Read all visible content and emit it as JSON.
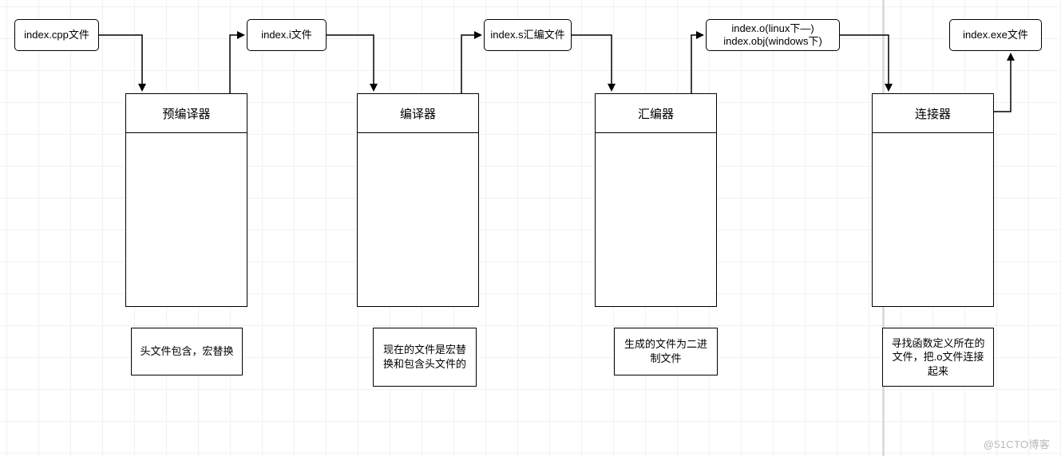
{
  "chart_data": {
    "type": "flowchart",
    "direction": "left-to-right",
    "nodes": [
      {
        "id": "n_src",
        "kind": "file",
        "label": "index.cpp文件"
      },
      {
        "id": "n_i",
        "kind": "file",
        "label": "index.i文件"
      },
      {
        "id": "n_s",
        "kind": "file",
        "label": "index.s汇编文件"
      },
      {
        "id": "n_o",
        "kind": "file",
        "label": "index.o(linux下—)\nindex.obj(windows下)"
      },
      {
        "id": "n_exe",
        "kind": "file",
        "label": "index.exe文件"
      },
      {
        "id": "s_pre",
        "kind": "stage",
        "label": "预编译器"
      },
      {
        "id": "s_comp",
        "kind": "stage",
        "label": "编译器"
      },
      {
        "id": "s_asm",
        "kind": "stage",
        "label": "汇编器"
      },
      {
        "id": "s_link",
        "kind": "stage",
        "label": "连接器"
      },
      {
        "id": "d_pre",
        "kind": "desc",
        "label": "头文件包含，宏替换"
      },
      {
        "id": "d_comp",
        "kind": "desc",
        "label": "现在的文件是宏替换和包含头文件的"
      },
      {
        "id": "d_asm",
        "kind": "desc",
        "label": "生成的文件为二进制文件"
      },
      {
        "id": "d_link",
        "kind": "desc",
        "label": "寻找函数定义所在的文件，把.o文件连接起来"
      }
    ],
    "edges": [
      {
        "from": "n_src",
        "to": "s_pre"
      },
      {
        "from": "s_pre",
        "to": "n_i"
      },
      {
        "from": "n_i",
        "to": "s_comp"
      },
      {
        "from": "s_comp",
        "to": "n_s"
      },
      {
        "from": "n_s",
        "to": "s_asm"
      },
      {
        "from": "s_asm",
        "to": "n_o"
      },
      {
        "from": "n_o",
        "to": "s_link"
      },
      {
        "from": "s_link",
        "to": "n_exe"
      }
    ]
  },
  "files": {
    "src": "index.cpp文件",
    "i": "index.i文件",
    "s": "index.s汇编文件",
    "o": "index.o(linux下—)\nindex.obj(windows下)",
    "exe": "index.exe文件"
  },
  "stages": {
    "pre": "预编译器",
    "comp": "编译器",
    "asm": "汇编器",
    "link": "连接器"
  },
  "descs": {
    "pre": "头文件包含，宏替换",
    "comp": "现在的文件是宏替换和包含头文件的",
    "asm": "生成的文件为二进制文件",
    "link": "寻找函数定义所在的文件，把.o文件连接起来"
  },
  "watermark": "@51CTO博客"
}
